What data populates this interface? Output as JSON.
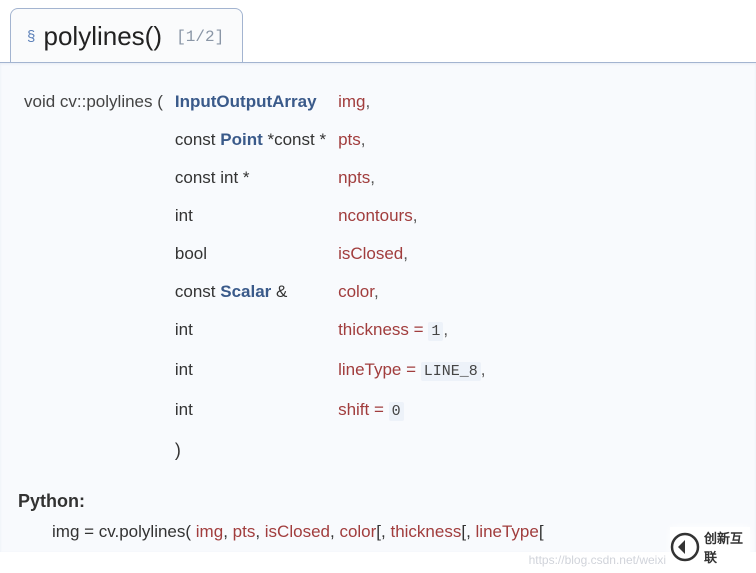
{
  "header": {
    "section_mark": "§",
    "function_name": "polylines()",
    "counter": "[1/2]"
  },
  "signature": {
    "return_decl": "void cv::polylines (",
    "close_paren": ")",
    "rows": [
      {
        "type_prefix": "",
        "type_link": "InputOutputArray",
        "type_suffix": "",
        "name": "img",
        "tail": ","
      },
      {
        "type_prefix": "const ",
        "type_link": "Point",
        "type_suffix": " *const *",
        "name": "pts",
        "tail": ","
      },
      {
        "type_prefix": "const int *",
        "type_link": "",
        "type_suffix": "",
        "name": "npts",
        "tail": ","
      },
      {
        "type_prefix": "int",
        "type_link": "",
        "type_suffix": "",
        "name": "ncontours",
        "tail": ","
      },
      {
        "type_prefix": "bool",
        "type_link": "",
        "type_suffix": "",
        "name": "isClosed",
        "tail": ","
      },
      {
        "type_prefix": "const ",
        "type_link": "Scalar",
        "type_suffix": " &",
        "name": "color",
        "tail": ","
      },
      {
        "type_prefix": "int",
        "type_link": "",
        "type_suffix": "",
        "name_prefix": "thickness = ",
        "literal": "1",
        "tail": ","
      },
      {
        "type_prefix": "int",
        "type_link": "",
        "type_suffix": "",
        "name_prefix": "lineType = ",
        "literal": "LINE_8",
        "tail": ","
      },
      {
        "type_prefix": "int",
        "type_link": "",
        "type_suffix": "",
        "name_prefix": "shift = ",
        "literal": "0",
        "tail": ""
      }
    ]
  },
  "python": {
    "label": "Python:",
    "lhs": "img = cv.polylines(",
    "args": [
      "img",
      "pts",
      "isClosed",
      "color"
    ],
    "optional_open": "[, ",
    "optional1": "thickness",
    "optional2": "lineType",
    "optional_open2": "[, ",
    "optional_trail": "["
  },
  "watermark": {
    "url": "https://blog.csdn.net/weixi",
    "brand": "创新互联"
  }
}
